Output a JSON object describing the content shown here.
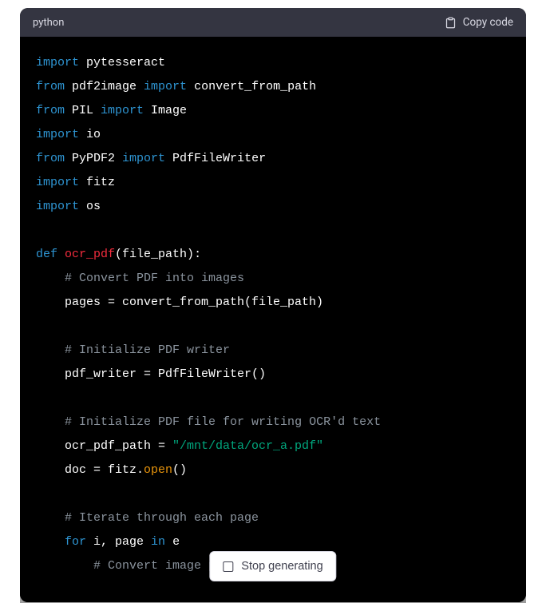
{
  "header": {
    "language_label": "python",
    "copy_label": "Copy code"
  },
  "code": {
    "lines": [
      {
        "t": [
          {
            "c": "tok-kw",
            "v": "import"
          },
          {
            "c": "",
            "v": " pytesseract"
          }
        ]
      },
      {
        "t": [
          {
            "c": "tok-kw",
            "v": "from"
          },
          {
            "c": "",
            "v": " pdf2image "
          },
          {
            "c": "tok-kw",
            "v": "import"
          },
          {
            "c": "",
            "v": " convert_from_path"
          }
        ]
      },
      {
        "t": [
          {
            "c": "tok-kw",
            "v": "from"
          },
          {
            "c": "",
            "v": " PIL "
          },
          {
            "c": "tok-kw",
            "v": "import"
          },
          {
            "c": "",
            "v": " Image"
          }
        ]
      },
      {
        "t": [
          {
            "c": "tok-kw",
            "v": "import"
          },
          {
            "c": "",
            "v": " io"
          }
        ]
      },
      {
        "t": [
          {
            "c": "tok-kw",
            "v": "from"
          },
          {
            "c": "",
            "v": " PyPDF2 "
          },
          {
            "c": "tok-kw",
            "v": "import"
          },
          {
            "c": "",
            "v": " PdfFileWriter"
          }
        ]
      },
      {
        "t": [
          {
            "c": "tok-kw",
            "v": "import"
          },
          {
            "c": "",
            "v": " fitz"
          }
        ]
      },
      {
        "t": [
          {
            "c": "tok-kw",
            "v": "import"
          },
          {
            "c": "",
            "v": " os"
          }
        ]
      },
      {
        "t": [
          {
            "c": "",
            "v": ""
          }
        ]
      },
      {
        "t": [
          {
            "c": "tok-kw",
            "v": "def"
          },
          {
            "c": "",
            "v": " "
          },
          {
            "c": "tok-fname",
            "v": "ocr_pdf"
          },
          {
            "c": "",
            "v": "(file_path):"
          }
        ]
      },
      {
        "t": [
          {
            "c": "",
            "v": "    "
          },
          {
            "c": "tok-comment",
            "v": "# Convert PDF into images"
          }
        ]
      },
      {
        "t": [
          {
            "c": "",
            "v": "    pages = convert_from_path(file_path)"
          }
        ]
      },
      {
        "t": [
          {
            "c": "",
            "v": ""
          }
        ]
      },
      {
        "t": [
          {
            "c": "",
            "v": "    "
          },
          {
            "c": "tok-comment",
            "v": "# Initialize PDF writer"
          }
        ]
      },
      {
        "t": [
          {
            "c": "",
            "v": "    pdf_writer = PdfFileWriter()"
          }
        ]
      },
      {
        "t": [
          {
            "c": "",
            "v": ""
          }
        ]
      },
      {
        "t": [
          {
            "c": "",
            "v": "    "
          },
          {
            "c": "tok-comment",
            "v": "# Initialize PDF file for writing OCR'd text"
          }
        ]
      },
      {
        "t": [
          {
            "c": "",
            "v": "    ocr_pdf_path = "
          },
          {
            "c": "tok-str",
            "v": "\"/mnt/data/ocr_a.pdf\""
          }
        ]
      },
      {
        "t": [
          {
            "c": "",
            "v": "    doc = fitz."
          },
          {
            "c": "tok-builtin",
            "v": "open"
          },
          {
            "c": "",
            "v": "()"
          }
        ]
      },
      {
        "t": [
          {
            "c": "",
            "v": ""
          }
        ]
      },
      {
        "t": [
          {
            "c": "",
            "v": "    "
          },
          {
            "c": "tok-comment",
            "v": "# Iterate through each page"
          }
        ]
      },
      {
        "t": [
          {
            "c": "",
            "v": "    "
          },
          {
            "c": "tok-kw",
            "v": "for"
          },
          {
            "c": "",
            "v": " i, page "
          },
          {
            "c": "tok-kw",
            "v": "in"
          },
          {
            "c": "",
            "v": " e"
          }
        ]
      },
      {
        "t": [
          {
            "c": "",
            "v": "        "
          },
          {
            "c": "tok-comment",
            "v": "# Convert image page to bytes"
          }
        ]
      }
    ]
  },
  "stop": {
    "label": "Stop generating"
  }
}
